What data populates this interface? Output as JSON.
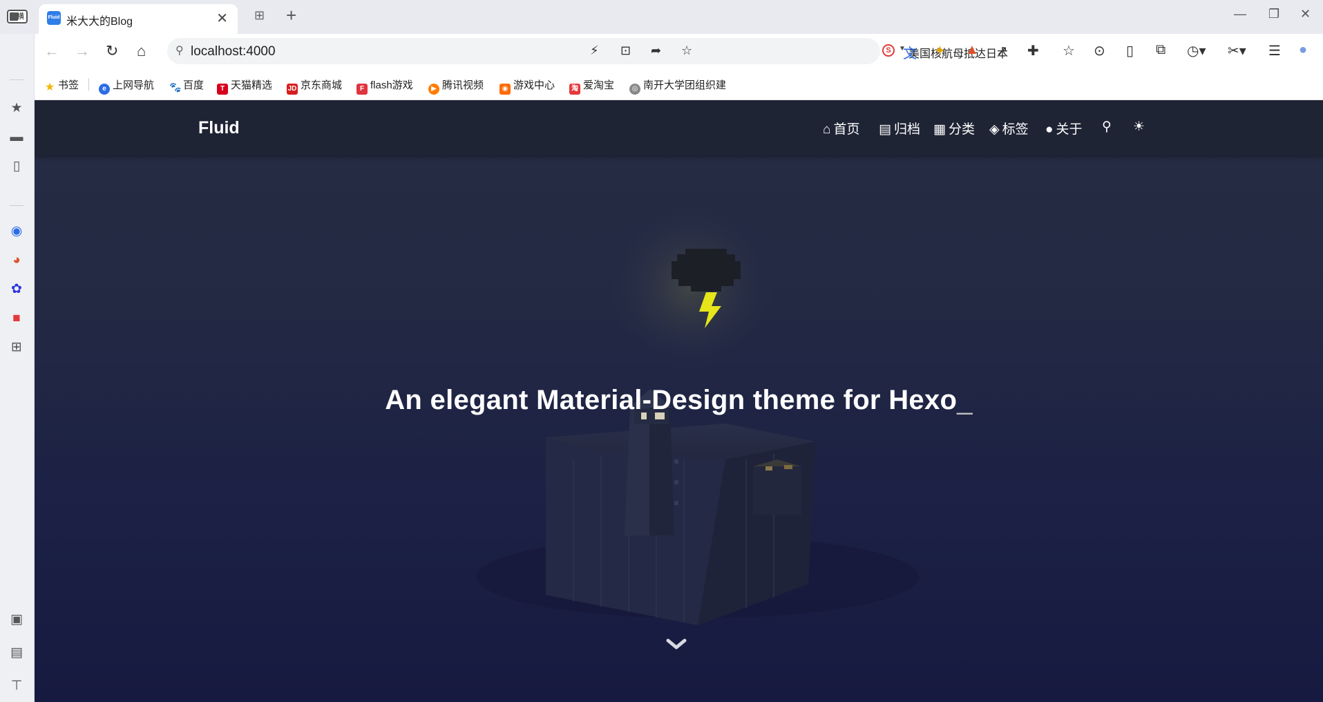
{
  "browser": {
    "tab": {
      "title": "米大大的Blog",
      "favicon_text": "Fluid",
      "close": "✕"
    },
    "new_tab": "+",
    "address": {
      "url": "localhost:4000",
      "search_suggestion": "美国核航母抵达日本"
    },
    "bookmarks": [
      {
        "label": "书签",
        "icon": "star-icon",
        "color": "#f5b400"
      },
      {
        "label": "上网导航",
        "icon": "nav-icon",
        "color": "#2b6de8"
      },
      {
        "label": "百度",
        "icon": "baidu-icon",
        "color": "#2932e1"
      },
      {
        "label": "天猫精选",
        "icon": "tmall-icon",
        "color": "#d6001c"
      },
      {
        "label": "京东商城",
        "icon": "jd-icon",
        "color": "#d71e1e"
      },
      {
        "label": "flash游戏",
        "icon": "flash-icon",
        "color": "#e0343f"
      },
      {
        "label": "腾讯视频",
        "icon": "tencent-video-icon",
        "color": "#ff7d00"
      },
      {
        "label": "游戏中心",
        "icon": "game-icon",
        "color": "#ff6a00"
      },
      {
        "label": "爱淘宝",
        "icon": "taobao-icon",
        "color": "#e4393c"
      },
      {
        "label": "南开大学团组织建",
        "icon": "globe-icon",
        "color": "#666666"
      }
    ]
  },
  "site": {
    "brand": "Fluid",
    "nav": [
      {
        "label": "首页",
        "icon": "home-icon"
      },
      {
        "label": "归档",
        "icon": "archive-icon"
      },
      {
        "label": "分类",
        "icon": "category-icon"
      },
      {
        "label": "标签",
        "icon": "tags-icon"
      },
      {
        "label": "关于",
        "icon": "user-icon"
      }
    ],
    "headline": "An elegant Material-Design theme for Hexo",
    "cursor": "_",
    "colors": {
      "hero_bg": "#1c2145",
      "navbar": "#1e2434",
      "bolt": "#e6e61a"
    }
  }
}
